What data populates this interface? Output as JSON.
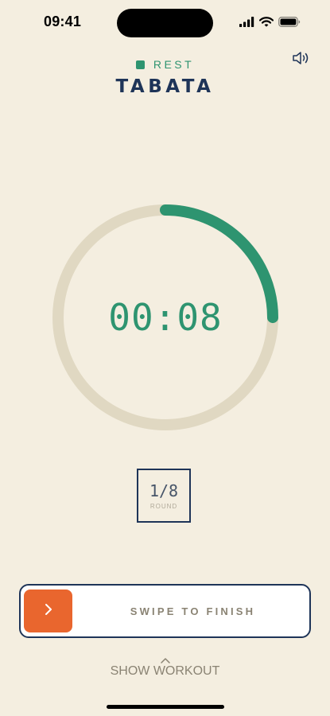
{
  "status_bar": {
    "time": "09:41",
    "icons": [
      "cellular-signal-icon",
      "wifi-icon",
      "battery-icon"
    ]
  },
  "mode": {
    "label": "REST",
    "color": "#2E9470"
  },
  "sound": {
    "icon": "speaker-icon"
  },
  "workout": {
    "title": "TABATA"
  },
  "timer": {
    "display": "00:08",
    "progress": 0.25,
    "track_color": "#E0D8C2",
    "progress_color": "#2E9470"
  },
  "round": {
    "value": "1/8",
    "label": "ROUND"
  },
  "swipe": {
    "label": "SWIPE TO FINISH",
    "handle_icon": "chevron-right-icon",
    "handle_color": "#E9662E"
  },
  "show_workout": {
    "label": "SHOW WORKOUT",
    "icon": "chevron-up-icon"
  },
  "colors": {
    "background": "#F4EEE0",
    "navy": "#1E3458"
  }
}
